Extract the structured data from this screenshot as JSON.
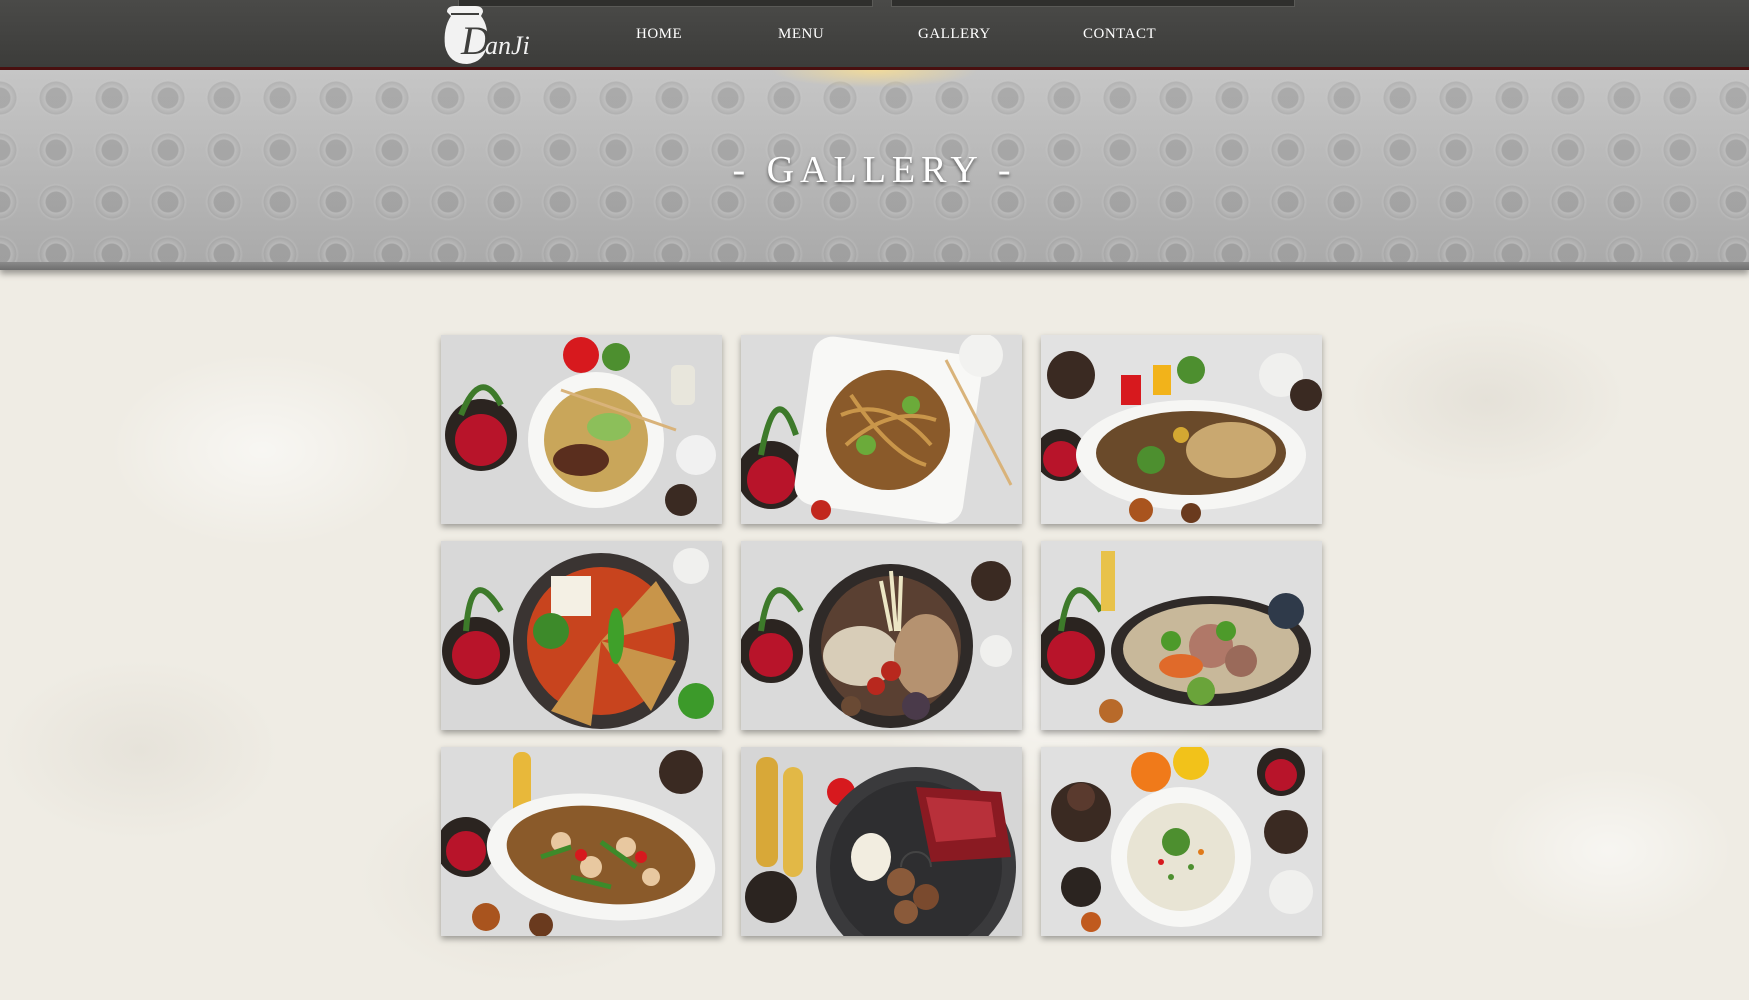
{
  "brand": {
    "logo_text": "Danji"
  },
  "nav": {
    "items": [
      {
        "label": "HOME"
      },
      {
        "label": "MENU"
      },
      {
        "label": "GALLERY"
      },
      {
        "label": "CONTACT"
      }
    ]
  },
  "banner": {
    "title": "- GALLERY -"
  },
  "gallery": {
    "photos": [
      {
        "dish": "beef-noodle-soup",
        "icon": "food-photo-icon"
      },
      {
        "dish": "stir-fried-noodles",
        "icon": "food-photo-icon"
      },
      {
        "dish": "bulgogi-fried-rice",
        "icon": "food-photo-icon"
      },
      {
        "dish": "spicy-hotpot",
        "icon": "food-photo-icon"
      },
      {
        "dish": "pork-trotter-hotpot",
        "icon": "food-photo-icon"
      },
      {
        "dish": "seafood-hotpot",
        "icon": "food-photo-icon"
      },
      {
        "dish": "spicy-chicken-stir-fry",
        "icon": "food-photo-icon"
      },
      {
        "dish": "grill-beef-mushrooms",
        "icon": "food-photo-icon"
      },
      {
        "dish": "rice-porridge",
        "icon": "food-photo-icon"
      }
    ]
  },
  "colors": {
    "nav_background": "#3f3f3d",
    "nav_accent": "#4a1010",
    "banner_background": "#b4b4b4",
    "page_background": "#efece4"
  }
}
